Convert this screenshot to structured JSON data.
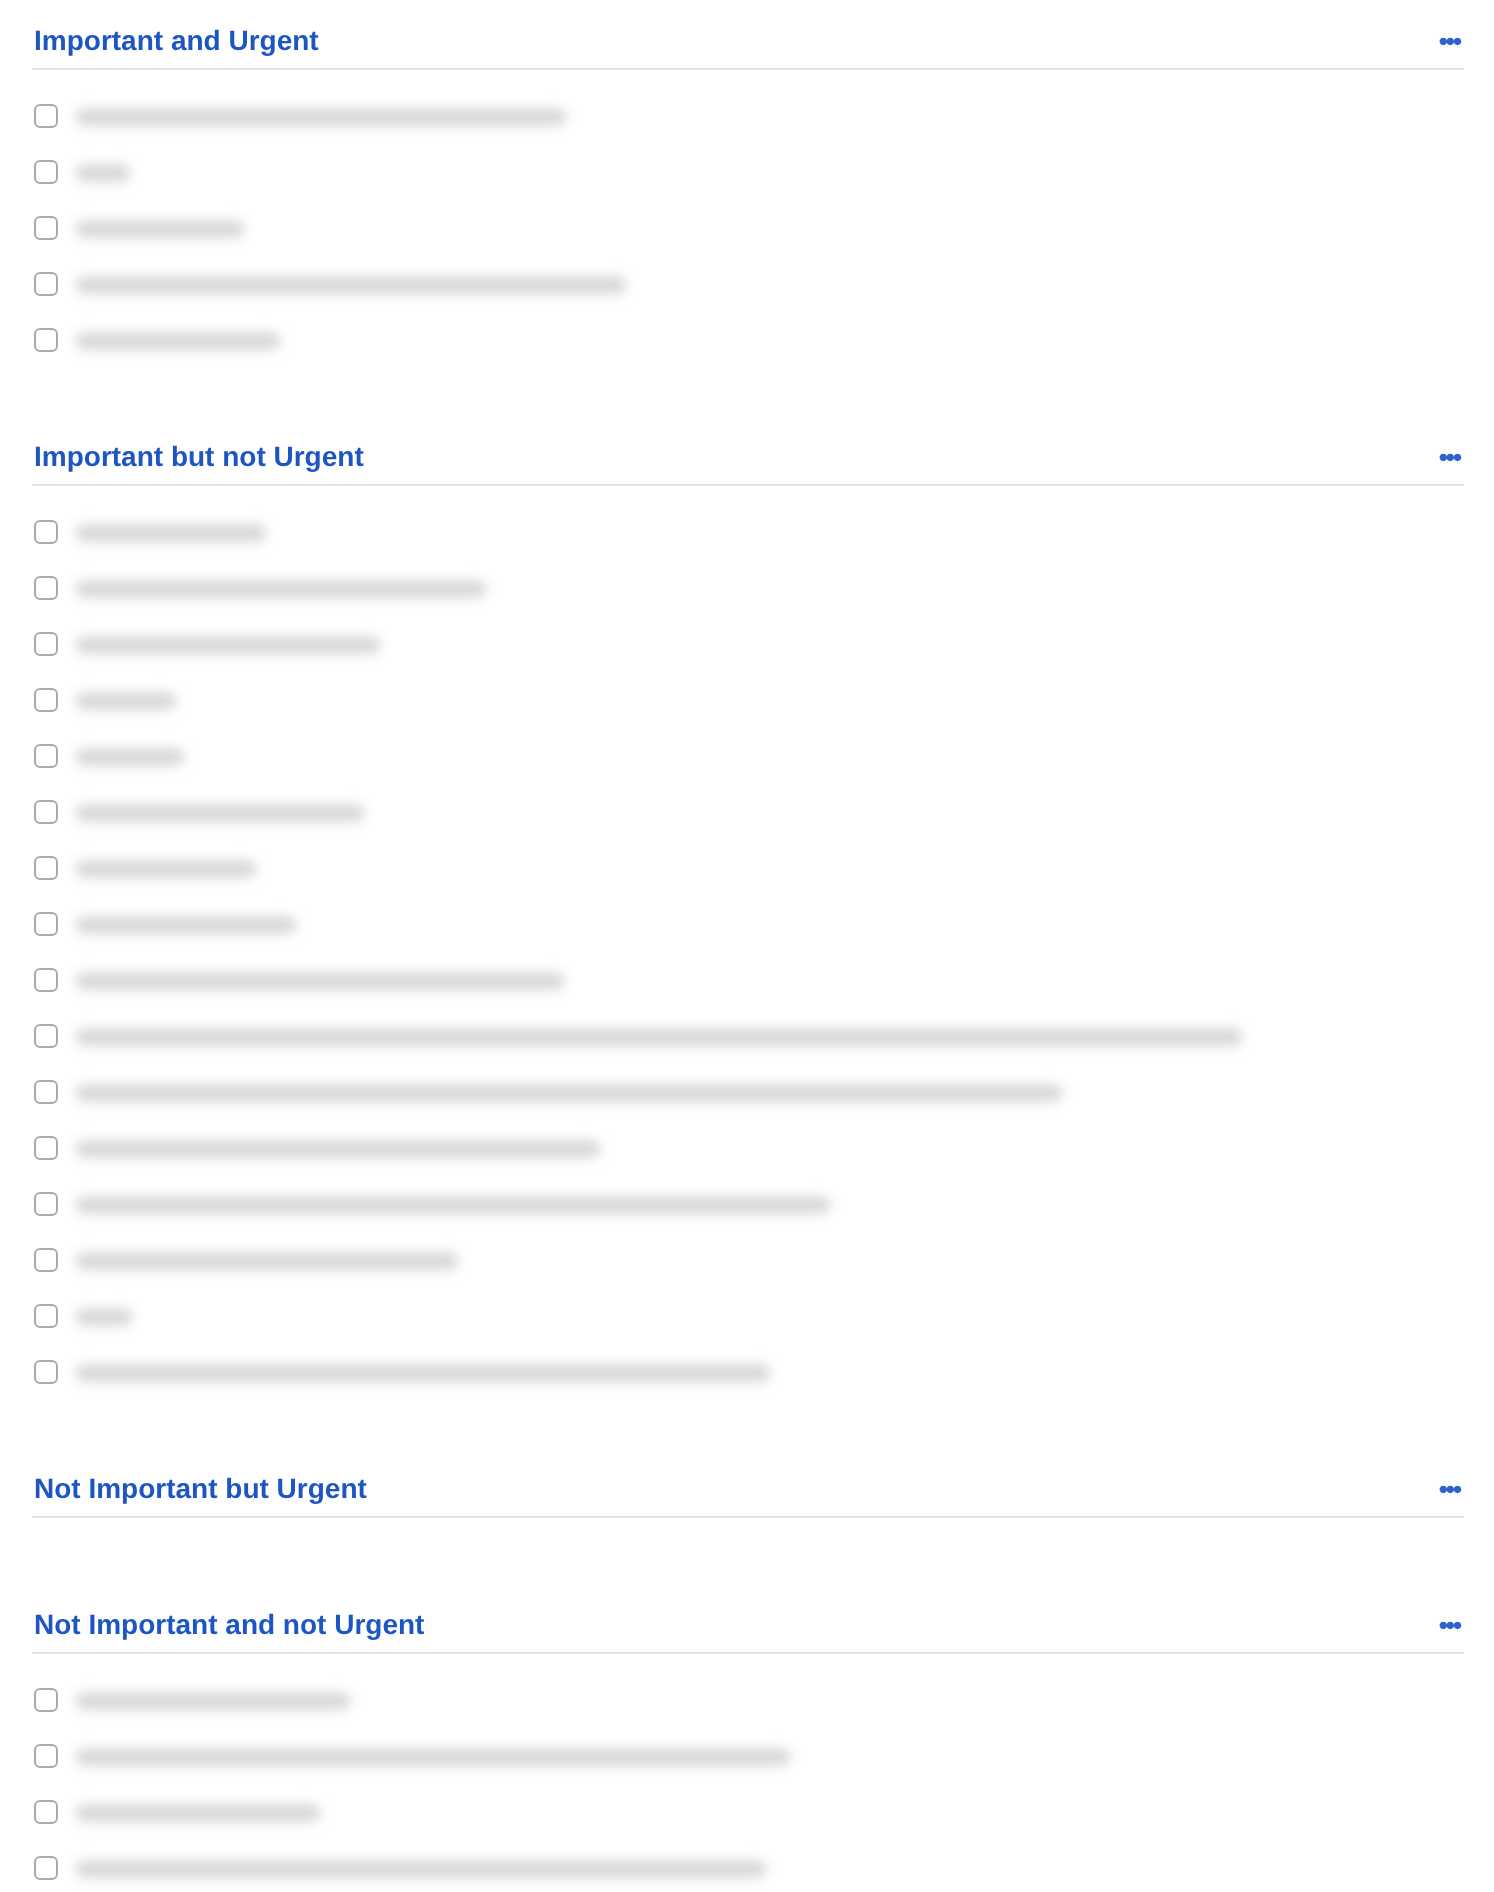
{
  "sections": [
    {
      "title": "Important and Urgent",
      "menu": "•••",
      "tasks": [
        {
          "checked": false
        },
        {
          "checked": false
        },
        {
          "checked": false
        },
        {
          "checked": false
        },
        {
          "checked": false
        }
      ]
    },
    {
      "title": "Important but not Urgent",
      "menu": "•••",
      "tasks": [
        {
          "checked": false
        },
        {
          "checked": false
        },
        {
          "checked": false
        },
        {
          "checked": false
        },
        {
          "checked": false
        },
        {
          "checked": false
        },
        {
          "checked": false
        },
        {
          "checked": false
        },
        {
          "checked": false
        },
        {
          "checked": false
        },
        {
          "checked": false
        },
        {
          "checked": false
        },
        {
          "checked": false
        },
        {
          "checked": false
        },
        {
          "checked": false
        },
        {
          "checked": false
        }
      ]
    },
    {
      "title": "Not Important but Urgent",
      "menu": "•••"
    },
    {
      "title": "Not Important and not Urgent",
      "menu": "•••",
      "tasks": [
        {
          "checked": false
        },
        {
          "checked": false
        },
        {
          "checked": false
        },
        {
          "checked": false
        }
      ]
    }
  ]
}
